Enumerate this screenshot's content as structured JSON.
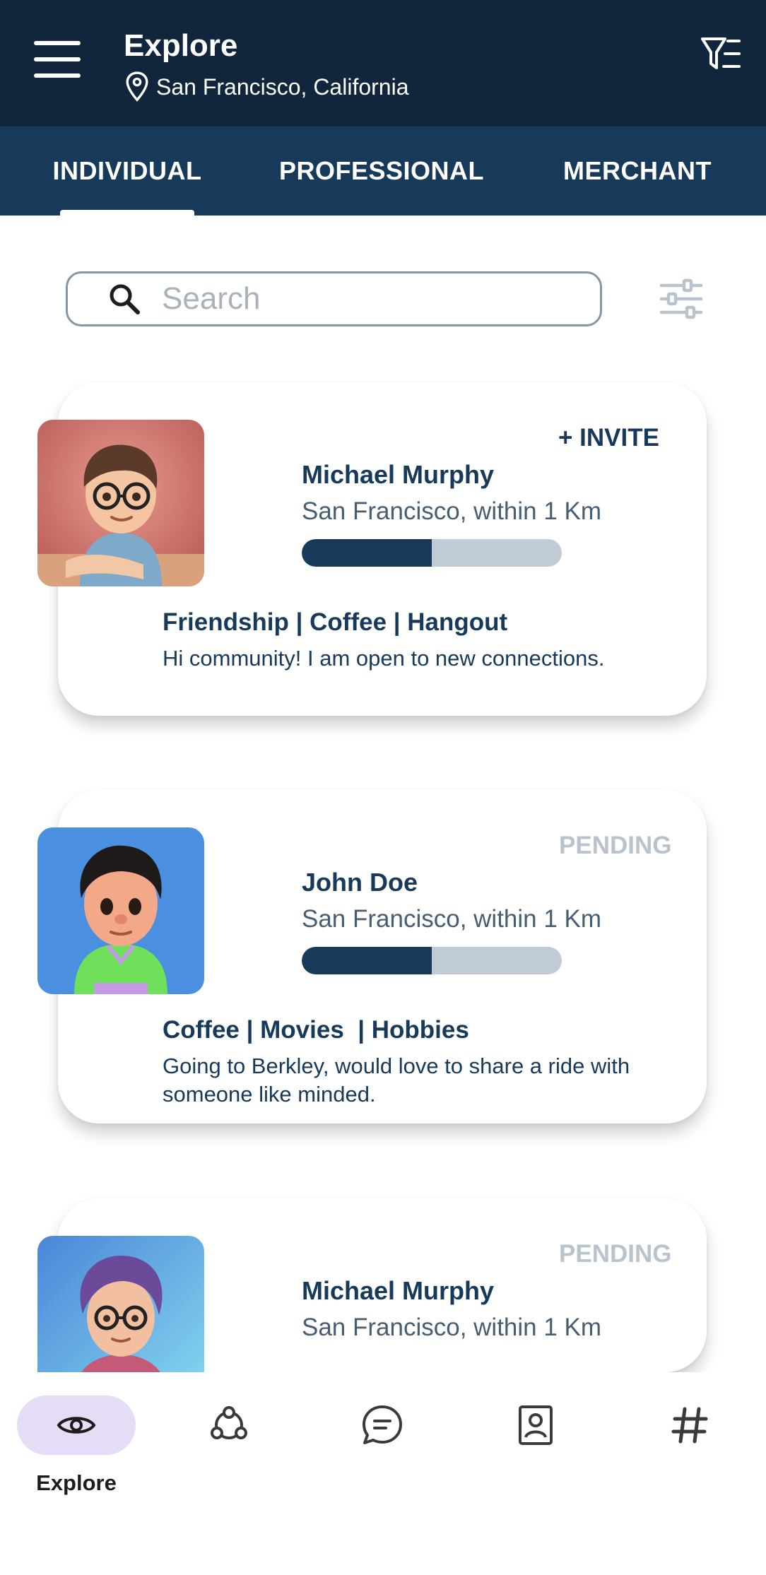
{
  "header": {
    "title": "Explore",
    "location": "San Francisco, California",
    "icons": {
      "menu": "hamburger-menu-icon",
      "location": "map-pin-icon",
      "filter": "filter-list-icon"
    }
  },
  "tabs": [
    {
      "label": "INDIVIDUAL",
      "active": true
    },
    {
      "label": "PROFESSIONAL",
      "active": false
    },
    {
      "label": "MERCHANT",
      "active": false
    }
  ],
  "search": {
    "placeholder": "Search",
    "value": "",
    "icon": "search-icon",
    "filter_icon": "sliders-icon"
  },
  "cards": [
    {
      "name": "Michael Murphy",
      "location": "San Francisco, within 1 Km",
      "action": "+ INVITE",
      "progress": 0.5,
      "tags": "Friendship | Coffee | Hangout",
      "description": "Hi community! I am open to new connections."
    },
    {
      "name": "John Doe",
      "location": "San Francisco, within 1 Km",
      "action": "PENDING",
      "progress": 0.5,
      "tags": "Coffee | Movies  | Hobbies",
      "description": "Going to Berkley, would love to share a ride with someone like minded."
    },
    {
      "name": "Michael Murphy",
      "location": "San Francisco, within 1 Km",
      "action": "PENDING"
    }
  ],
  "bottom_nav": [
    {
      "label": "Explore",
      "icon": "eye-icon",
      "active": true
    },
    {
      "label": "",
      "icon": "network-icon",
      "active": false
    },
    {
      "label": "",
      "icon": "chat-icon",
      "active": false
    },
    {
      "label": "",
      "icon": "contact-card-icon",
      "active": false
    },
    {
      "label": "",
      "icon": "hashtag-icon",
      "active": false
    }
  ],
  "colors": {
    "header_bg": "#11263d",
    "tabbar_bg": "#17395a",
    "accent": "#17395a",
    "pending": "#b9c3cd",
    "progress_track": "#c0cbd5",
    "nav_active_pill": "#e6dcf6"
  }
}
